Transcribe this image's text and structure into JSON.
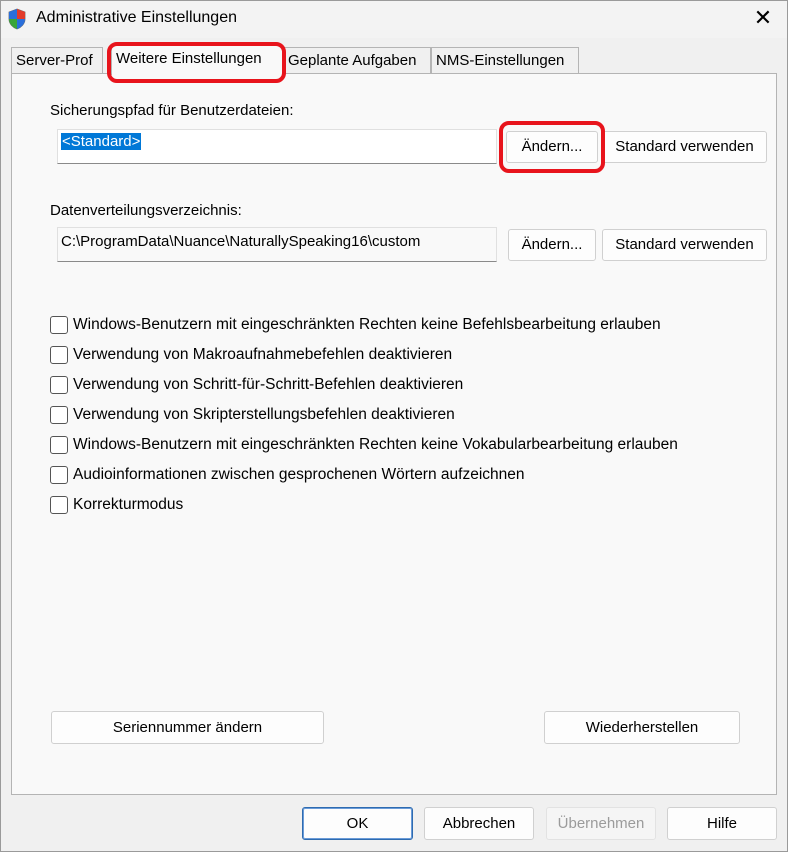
{
  "window": {
    "title": "Administrative Einstellungen"
  },
  "tabs": [
    "Server-Prof",
    "Weitere Einstellungen",
    "Geplante Aufgaben",
    "NMS-Einstellungen"
  ],
  "backup": {
    "label": "Sicherungspfad für Benutzerdateien:",
    "value": "<Standard>",
    "change_label": "Ändern...",
    "default_label": "Standard verwenden"
  },
  "distribution": {
    "label": "Datenverteilungsverzeichnis:",
    "value": "C:\\ProgramData\\Nuance\\NaturallySpeaking16\\custom",
    "change_label": "Ändern...",
    "default_label": "Standard verwenden"
  },
  "options": [
    "Windows-Benutzern mit eingeschränkten Rechten keine Befehlsbearbeitung erlauben",
    "Verwendung von Makroaufnahmebefehlen deaktivieren",
    "Verwendung von Schritt-für-Schritt-Befehlen deaktivieren",
    "Verwendung von Skripterstellungsbefehlen deaktivieren",
    "Windows-Benutzern mit eingeschränkten Rechten keine Vokabularbearbeitung erlauben",
    "Audioinformationen zwischen gesprochenen Wörtern aufzeichnen",
    "Korrekturmodus"
  ],
  "actions": {
    "serial_label": "Seriennummer ändern",
    "restore_label": "Wiederherstellen"
  },
  "footer": {
    "ok_label": "OK",
    "cancel_label": "Abbrechen",
    "apply_label": "Übernehmen",
    "help_label": "Hilfe"
  },
  "icons": {
    "app": "shield-icon",
    "close": "close-icon"
  },
  "colors": {
    "highlight": "#e8141c",
    "selection": "#0078d7"
  }
}
